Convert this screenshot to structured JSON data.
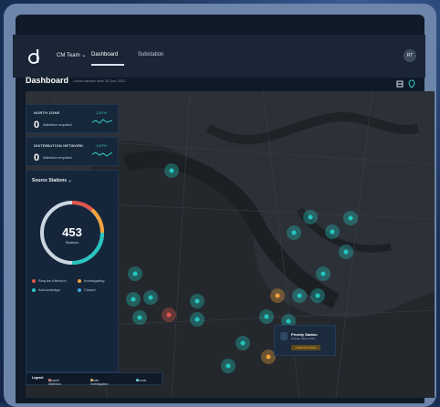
{
  "colors": {
    "accent": "#26c6c0",
    "alert": "#e0554a",
    "investigating": "#f0a23c",
    "closed": "#3aa7e3",
    "ring_track": "#cdd6e0"
  },
  "nav": {
    "team": "CM Team",
    "tabs": [
      {
        "label": "Dashboard",
        "active": true
      },
      {
        "label": "Substation",
        "active": false
      }
    ],
    "avatar": "RT"
  },
  "dashboard": {
    "title": "Dashboard",
    "subtitle": "Latest sample date 16 Dec 2022"
  },
  "zones": [
    {
      "label": "NORTH ZONE",
      "pct": "-2.67%",
      "count": "0",
      "text": "Attention required"
    },
    {
      "label": "DISTRIBUTION NETWORK",
      "pct": "-2.67%",
      "count": "0",
      "text": "Attention required"
    }
  ],
  "source": {
    "title": "Source Stations",
    "total": "453",
    "unit": "Stations",
    "legend": [
      {
        "label": "Require Attention",
        "color": "#e0554a"
      },
      {
        "label": "Investigating",
        "color": "#f0a23c"
      },
      {
        "label": "Acknowledge",
        "color": "#26c6c0"
      },
      {
        "label": "Closed",
        "color": "#3aa7e3"
      }
    ]
  },
  "map_legend": {
    "title": "Legend",
    "items": [
      {
        "label": "Require Attention",
        "color": "#e0554a"
      },
      {
        "label": "Under Investigation",
        "color": "#f0a23c"
      },
      {
        "label": "Normal",
        "color": "#26c6c0"
      }
    ]
  },
  "tooltip": {
    "title": "Priority Station",
    "sub": "Orange Street 0001",
    "status": "INVESTIGATING"
  },
  "icons": {
    "menu": "chevron-down-icon",
    "layers": "layers-icon",
    "pin": "location-pin-icon"
  }
}
